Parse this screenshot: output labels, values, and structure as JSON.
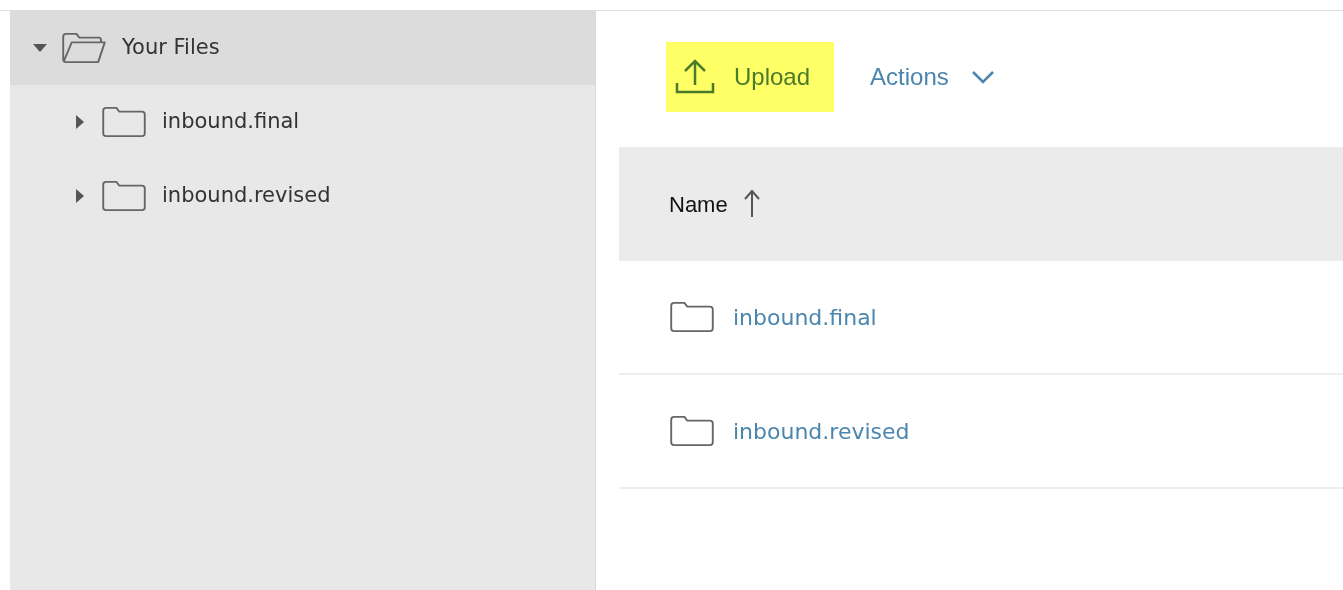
{
  "tree": [
    {
      "label": "Your Files",
      "expanded": true,
      "selected": true,
      "children": [
        {
          "label": "inbound.final",
          "expanded": false,
          "selected": false
        },
        {
          "label": "inbound.revised",
          "expanded": false,
          "selected": false
        }
      ]
    }
  ],
  "toolbar": {
    "upload": {
      "label": "Upload",
      "highlighted": true
    },
    "actions": {
      "label": "Actions"
    }
  },
  "table": {
    "columns": [
      {
        "label": "Name",
        "sorted": true
      }
    ],
    "rows": [
      {
        "name": "inbound.final"
      },
      {
        "name": "inbound.revised"
      }
    ]
  }
}
